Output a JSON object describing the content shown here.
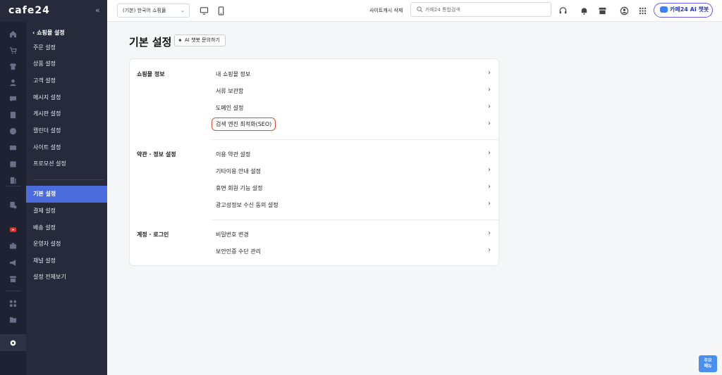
{
  "app": {
    "logo": "cafe24",
    "collapse_glyph": "«"
  },
  "sidebar": {
    "back_label": "쇼핑몰 설정",
    "items": [
      {
        "label": "주문 설정",
        "active": false
      },
      {
        "label": "상품 설정",
        "active": false
      },
      {
        "label": "고객 설정",
        "active": false
      },
      {
        "label": "메시지 설정",
        "active": false
      },
      {
        "label": "게시판 설정",
        "active": false
      },
      {
        "label": "캘린더 설정",
        "active": false
      },
      {
        "label": "사이트 설정",
        "active": false
      },
      {
        "label": "프로모션 설정",
        "active": false
      },
      {
        "label": "기본 설정",
        "active": true
      },
      {
        "label": "결제 설정",
        "active": false
      },
      {
        "label": "배송 설정",
        "active": false
      },
      {
        "label": "운영자 설정",
        "active": false
      },
      {
        "label": "채널 설정",
        "active": false
      },
      {
        "label": "설정 전체보기",
        "active": false
      }
    ],
    "rail_icons": [
      "home-icon",
      "cart-icon",
      "shirt-icon",
      "user-icon",
      "chat-icon",
      "board-icon",
      "palette-icon",
      "monitor-icon",
      "chart-icon",
      "book-icon",
      "receipt-icon",
      "youtube-icon",
      "briefcase-icon",
      "megaphone-icon",
      "store-icon",
      "apps-icon",
      "folder-icon",
      "gear-icon"
    ]
  },
  "topbar": {
    "mall_select": "(기본) 한국어 쇼핑몰",
    "cache_link": "사이트캐시 삭제",
    "search_placeholder": "카페24 통합검색",
    "ai_button": "카페24 AI 챗봇"
  },
  "main": {
    "title": "기본 설정",
    "chat_button": "AI 챗봇 문의하기",
    "sections": [
      {
        "title": "쇼핑몰 정보",
        "rows": [
          "내 쇼핑몰 정보",
          "서류 보관함",
          "도메인 설정",
          "검색 엔진 최적화(SEO)"
        ]
      },
      {
        "title": "약관 · 정보 설정",
        "rows": [
          "이용 약관 설정",
          "기타이용 안내 설정",
          "휴면 회원 기능 설정",
          "광고성정보 수신 동의 설정"
        ]
      },
      {
        "title": "계정 · 로그인",
        "rows": [
          "비밀번호 변경",
          "보안인증 수단 관리"
        ]
      }
    ],
    "highlighted_row": "검색 엔진 최적화(SEO)",
    "arrow_glyph": "›"
  },
  "quick_menu": {
    "line1": "주요",
    "line2": "메뉴"
  },
  "colors": {
    "sidebar_bg": "#262a3b",
    "rail_bg": "#1f2232",
    "active_item": "#4a6cdc",
    "highlight_border": "#e24b2f",
    "ai_border": "#6b5bf2",
    "quick_btn": "#4a8ff0"
  }
}
